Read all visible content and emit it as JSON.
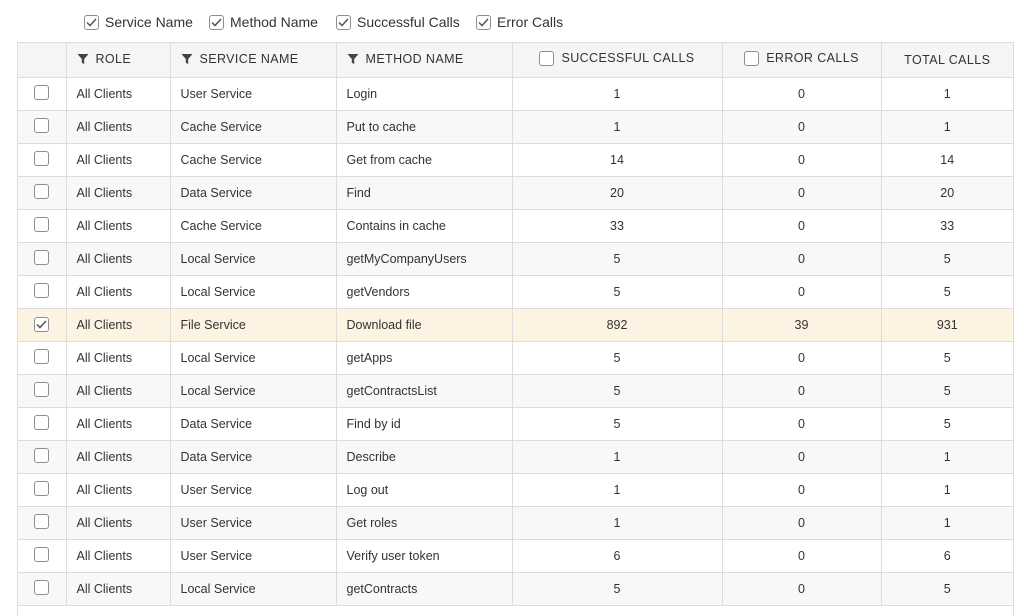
{
  "toggles": [
    {
      "label": "Service Name",
      "checked": true
    },
    {
      "label": "Method Name",
      "checked": true
    },
    {
      "label": "Successful Calls",
      "checked": true
    },
    {
      "label": "Error Calls",
      "checked": true
    }
  ],
  "columns": {
    "role": "ROLE",
    "service": "SERVICE NAME",
    "method": "METHOD NAME",
    "successful": "SUCCESSFUL CALLS",
    "errors": "ERROR CALLS",
    "total": "TOTAL CALLS"
  },
  "rows": [
    {
      "checked": false,
      "role": "All Clients",
      "service": "User Service",
      "method": "Login",
      "successful": "1",
      "errors": "0",
      "total": "1"
    },
    {
      "checked": false,
      "role": "All Clients",
      "service": "Cache Service",
      "method": "Put to cache",
      "successful": "1",
      "errors": "0",
      "total": "1"
    },
    {
      "checked": false,
      "role": "All Clients",
      "service": "Cache Service",
      "method": "Get from cache",
      "successful": "14",
      "errors": "0",
      "total": "14"
    },
    {
      "checked": false,
      "role": "All Clients",
      "service": "Data Service",
      "method": "Find",
      "successful": "20",
      "errors": "0",
      "total": "20"
    },
    {
      "checked": false,
      "role": "All Clients",
      "service": "Cache Service",
      "method": "Contains in cache",
      "successful": "33",
      "errors": "0",
      "total": "33"
    },
    {
      "checked": false,
      "role": "All Clients",
      "service": "Local Service",
      "method": "getMyCompanyUsers",
      "successful": "5",
      "errors": "0",
      "total": "5"
    },
    {
      "checked": false,
      "role": "All Clients",
      "service": "Local Service",
      "method": "getVendors",
      "successful": "5",
      "errors": "0",
      "total": "5"
    },
    {
      "checked": true,
      "role": "All Clients",
      "service": "File Service",
      "method": "Download file",
      "successful": "892",
      "errors": "39",
      "total": "931"
    },
    {
      "checked": false,
      "role": "All Clients",
      "service": "Local Service",
      "method": "getApps",
      "successful": "5",
      "errors": "0",
      "total": "5"
    },
    {
      "checked": false,
      "role": "All Clients",
      "service": "Local Service",
      "method": "getContractsList",
      "successful": "5",
      "errors": "0",
      "total": "5"
    },
    {
      "checked": false,
      "role": "All Clients",
      "service": "Data Service",
      "method": "Find by id",
      "successful": "5",
      "errors": "0",
      "total": "5"
    },
    {
      "checked": false,
      "role": "All Clients",
      "service": "Data Service",
      "method": "Describe",
      "successful": "1",
      "errors": "0",
      "total": "1"
    },
    {
      "checked": false,
      "role": "All Clients",
      "service": "User Service",
      "method": "Log out",
      "successful": "1",
      "errors": "0",
      "total": "1"
    },
    {
      "checked": false,
      "role": "All Clients",
      "service": "User Service",
      "method": "Get roles",
      "successful": "1",
      "errors": "0",
      "total": "1"
    },
    {
      "checked": false,
      "role": "All Clients",
      "service": "User Service",
      "method": "Verify user token",
      "successful": "6",
      "errors": "0",
      "total": "6"
    },
    {
      "checked": false,
      "role": "All Clients",
      "service": "Local Service",
      "method": "getContracts",
      "successful": "5",
      "errors": "0",
      "total": "5"
    }
  ]
}
